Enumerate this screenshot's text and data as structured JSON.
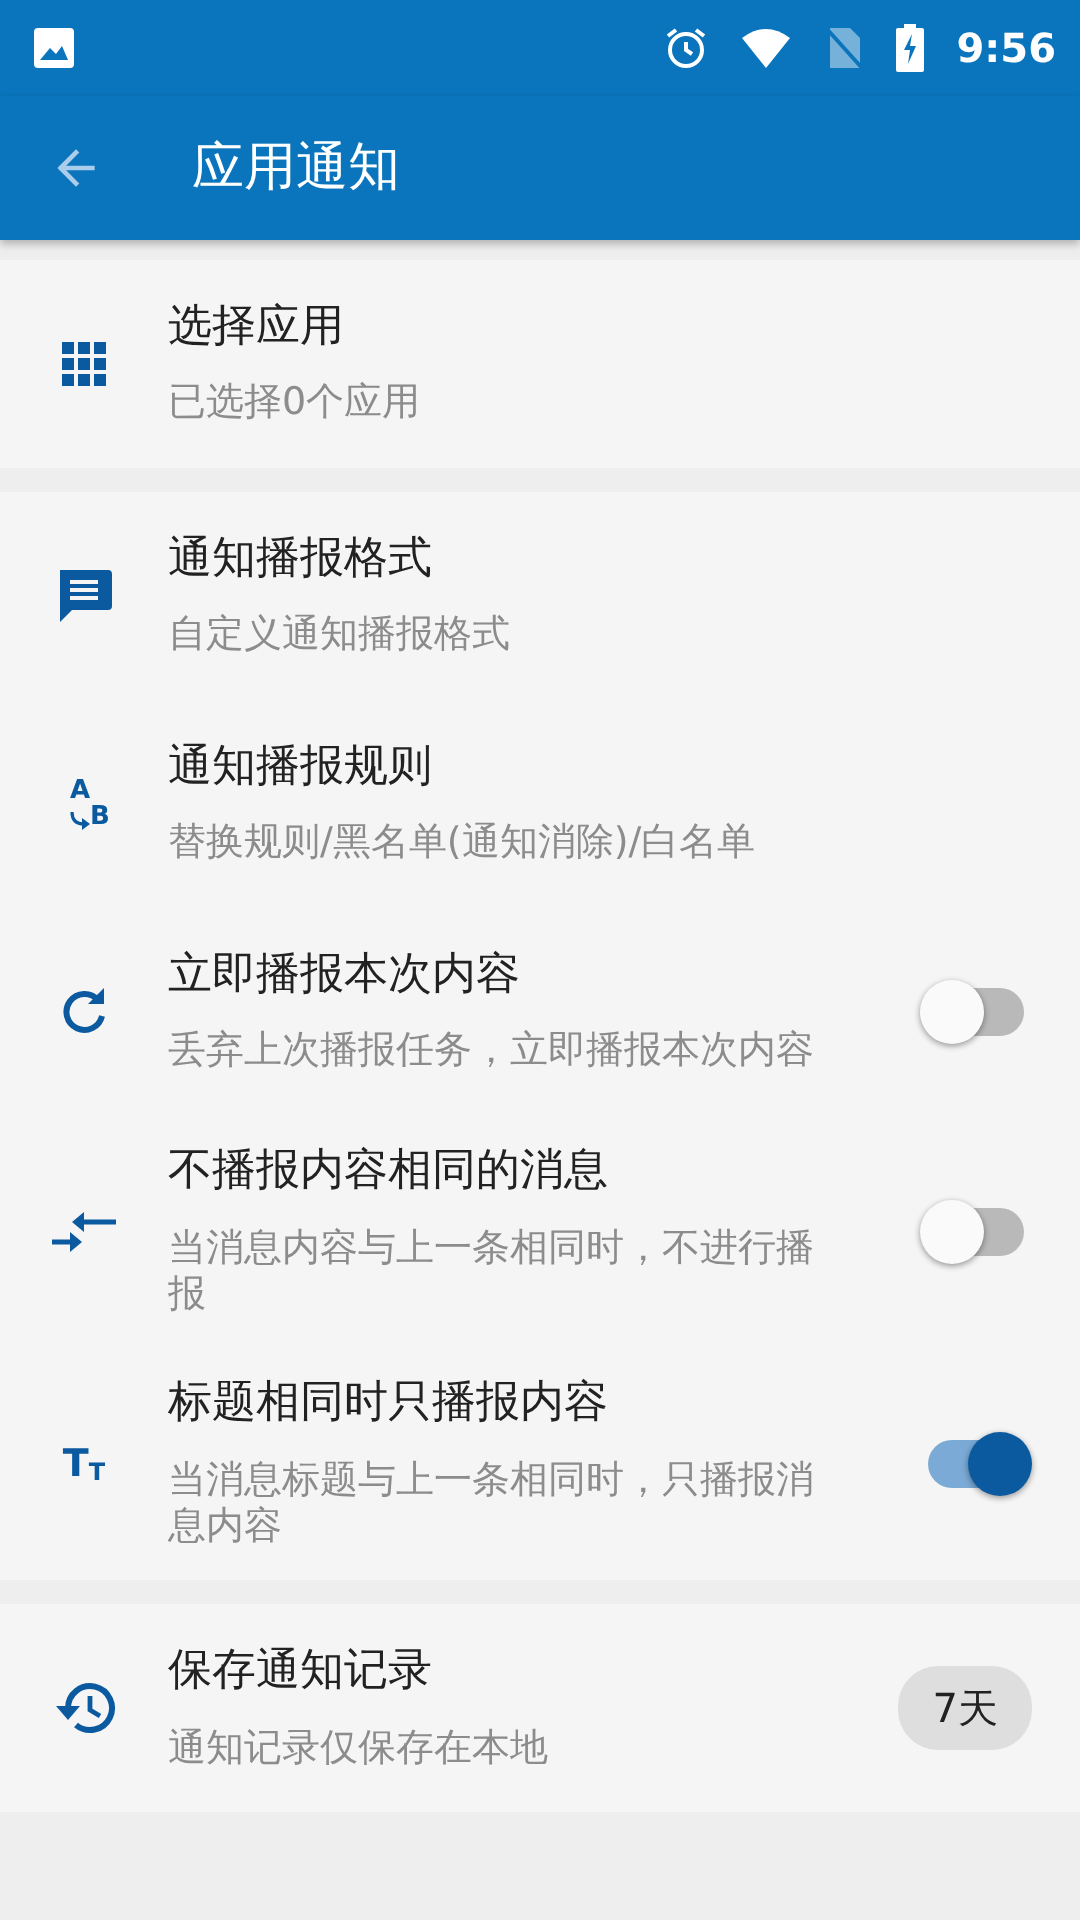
{
  "status_bar": {
    "time": "9:56"
  },
  "toolbar": {
    "title": "应用通知"
  },
  "sections": [
    {
      "items": [
        {
          "title": "选择应用",
          "subtitle": "已选择0个应用",
          "kind": "plain"
        }
      ]
    },
    {
      "items": [
        {
          "title": "通知播报格式",
          "subtitle": "自定义通知播报格式",
          "kind": "plain"
        },
        {
          "icon_text": [
            "A",
            "B"
          ],
          "title": "通知播报规则",
          "subtitle": "替换规则/黑名单(通知消除)/白名单",
          "kind": "plain"
        },
        {
          "title": "立即播报本次内容",
          "subtitle": "丢弃上次播报任务，立即播报本次内容",
          "kind": "switch",
          "on": false
        },
        {
          "title": "不播报内容相同的消息",
          "subtitle": "当消息内容与上一条相同时，不进行播报",
          "kind": "switch",
          "on": false
        },
        {
          "icon_text": [
            "T",
            "T"
          ],
          "title": "标题相同时只播报内容",
          "subtitle": "当消息标题与上一条相同时，只播报消息内容",
          "kind": "switch",
          "on": true
        }
      ]
    },
    {
      "items": [
        {
          "title": "保存通知记录",
          "subtitle": "通知记录仅保存在本地",
          "kind": "chip",
          "chip": "7天"
        }
      ]
    }
  ]
}
